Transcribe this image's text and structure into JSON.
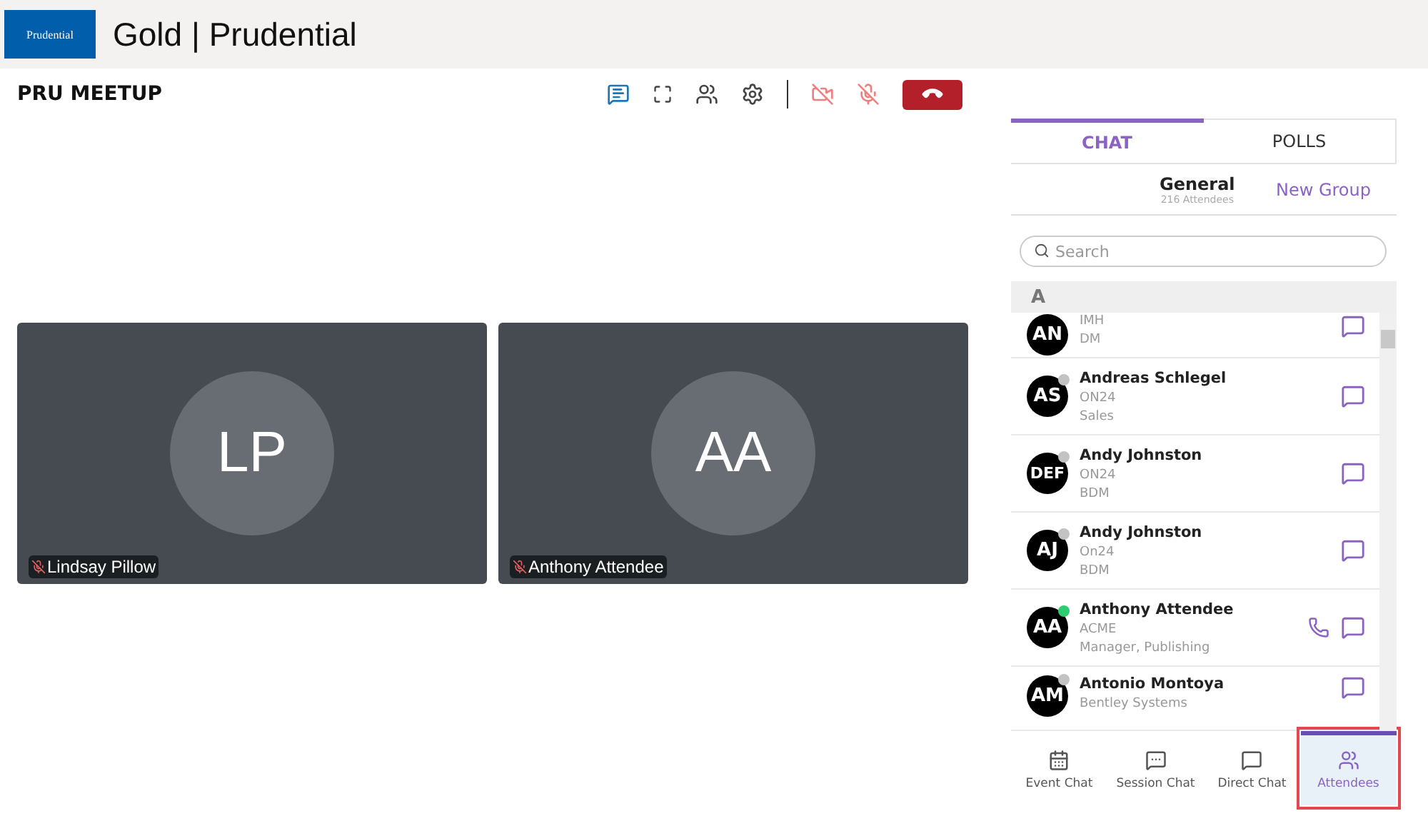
{
  "header": {
    "logo": "Prudential",
    "title": "Gold | Prudential"
  },
  "meeting": {
    "title": "PRU MEETUP"
  },
  "toolbar": [
    {
      "kind": "chat",
      "active": true
    },
    {
      "kind": "fullscreen",
      "active": false
    },
    {
      "kind": "people",
      "active": false
    },
    {
      "kind": "settings",
      "active": false
    },
    {
      "kind": "camera",
      "muted": true
    },
    {
      "kind": "mic",
      "muted": true
    },
    {
      "kind": "hangup"
    }
  ],
  "videos": [
    {
      "initials": "LP",
      "name": "Lindsay Pillow",
      "muted": true
    },
    {
      "initials": "AA",
      "name": "Anthony Attendee",
      "muted": true
    }
  ],
  "panel": {
    "tabs": [
      {
        "label": "CHAT",
        "selected": true
      },
      {
        "label": "POLLS",
        "selected": false
      }
    ],
    "group": {
      "name": "General",
      "count": "216 Attendees",
      "action": "New Group"
    },
    "search": {
      "placeholder": "Search"
    },
    "section": "A",
    "attendees": [
      {
        "initials": "AN",
        "org": "IMH",
        "role": "DM"
      },
      {
        "initials": "AS",
        "name": "Andreas Schlegel",
        "org": "ON24",
        "role": "Sales",
        "online": false,
        "call": false
      },
      {
        "initials": "DEF",
        "name": "Andy Johnston",
        "org": "ON24",
        "role": "BDM",
        "online": false,
        "call": false
      },
      {
        "initials": "AJ",
        "name": "Andy Johnston",
        "org": "On24",
        "role": "BDM",
        "online": false,
        "call": false
      },
      {
        "initials": "AA",
        "name": "Anthony Attendee",
        "org": "ACME",
        "role": "Manager, Publishing",
        "online": true,
        "call": true
      },
      {
        "initials": "AM",
        "name": "Antonio Montoya",
        "org": "Bentley Systems",
        "online": false,
        "call": false
      }
    ]
  },
  "bottom_nav": [
    {
      "kind": "event",
      "label": "Event Chat",
      "selected": false,
      "highlighted": false
    },
    {
      "kind": "session",
      "label": "Session Chat",
      "selected": false,
      "highlighted": false
    },
    {
      "kind": "direct",
      "label": "Direct Chat",
      "selected": false,
      "highlighted": false
    },
    {
      "kind": "attendees",
      "label": "Attendees",
      "selected": true,
      "highlighted": true
    }
  ]
}
